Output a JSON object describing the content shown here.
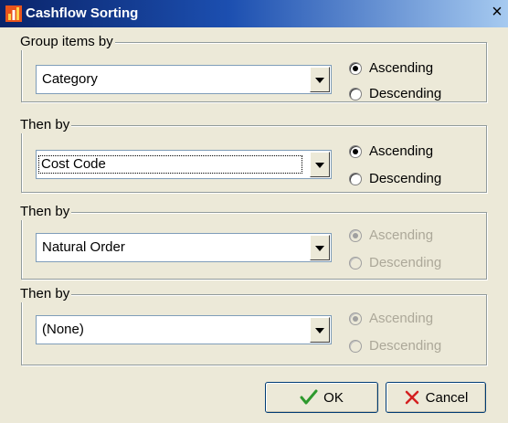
{
  "window": {
    "title": "Cashflow Sorting",
    "close_label": "×"
  },
  "groups": [
    {
      "legend": "Group items by",
      "combo_value": "Category",
      "ascending_label": "Ascending",
      "descending_label": "Descending",
      "selected": "ascending",
      "enabled": true
    },
    {
      "legend": "Then by",
      "combo_value": "Cost Code",
      "ascending_label": "Ascending",
      "descending_label": "Descending",
      "selected": "ascending",
      "enabled": true
    },
    {
      "legend": "Then by",
      "combo_value": "Natural Order",
      "ascending_label": "Ascending",
      "descending_label": "Descending",
      "selected": "ascending",
      "enabled": false
    },
    {
      "legend": "Then by",
      "combo_value": "(None)",
      "ascending_label": "Ascending",
      "descending_label": "Descending",
      "selected": "ascending",
      "enabled": false
    }
  ],
  "buttons": {
    "ok_label": "OK",
    "cancel_label": "Cancel"
  },
  "colors": {
    "title_bar_start": "#0a246a",
    "title_bar_end": "#a6caf0",
    "ok_check": "#2e9a2e",
    "cancel_x": "#d42020"
  }
}
